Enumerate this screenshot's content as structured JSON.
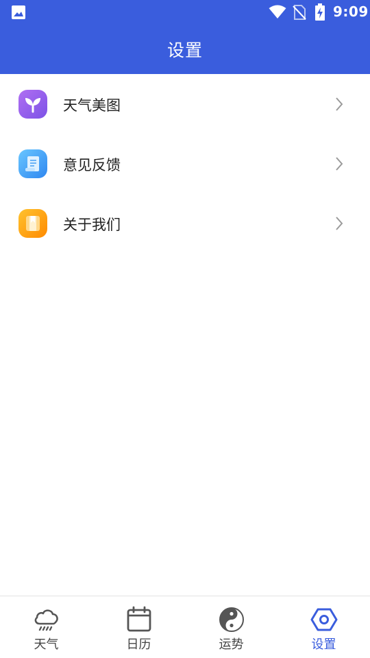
{
  "status_bar": {
    "time": "9:09",
    "icons": [
      "gallery-icon",
      "wifi-icon",
      "no-sim-icon",
      "battery-charging-icon"
    ]
  },
  "app_bar": {
    "title": "设置"
  },
  "settings": {
    "items": [
      {
        "label": "天气美图",
        "icon": "plant-icon",
        "color": "#8d5ef0"
      },
      {
        "label": "意见反馈",
        "icon": "scroll-icon",
        "color": "#3d9cf5"
      },
      {
        "label": "关于我们",
        "icon": "book-icon",
        "color": "#ffa013"
      }
    ]
  },
  "bottom_nav": {
    "items": [
      {
        "label": "天气",
        "icon": "rain-cloud-icon",
        "active": false
      },
      {
        "label": "日历",
        "icon": "calendar-icon",
        "active": false
      },
      {
        "label": "运势",
        "icon": "yin-yang-icon",
        "active": false
      },
      {
        "label": "设置",
        "icon": "hex-settings-icon",
        "active": true
      }
    ]
  },
  "colors": {
    "primary": "#3a5ddd",
    "text": "#222222",
    "nav_inactive": "#444444",
    "chevron": "#9a9a9a"
  }
}
